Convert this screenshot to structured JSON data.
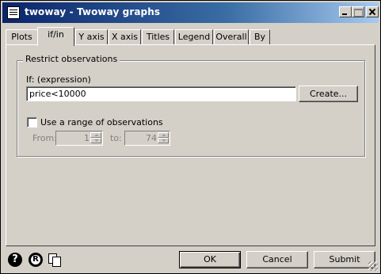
{
  "window": {
    "title": "twoway - Twoway graphs",
    "icon": "form-icon"
  },
  "tabs": [
    {
      "label": "Plots",
      "active": false
    },
    {
      "label": "if/in",
      "active": true
    },
    {
      "label": "Y axis",
      "active": false
    },
    {
      "label": "X axis",
      "active": false
    },
    {
      "label": "Titles",
      "active": false
    },
    {
      "label": "Legend",
      "active": false
    },
    {
      "label": "Overall",
      "active": false
    },
    {
      "label": "By",
      "active": false
    }
  ],
  "restrict": {
    "group_label": "Restrict observations",
    "if_label": "If: (expression)",
    "if_value": "price<10000",
    "create_label": "Create...",
    "range_checkbox_label": "Use a range of observations",
    "range_checked": false,
    "from_label": "From:",
    "from_value": "1",
    "to_label": "to:",
    "to_value": "74"
  },
  "footer": {
    "help_icon": "help-icon",
    "reset_icon": "reset-icon",
    "copy_icon": "copy-icon",
    "help_glyph": "?",
    "reset_glyph": "R",
    "ok_label": "OK",
    "cancel_label": "Cancel",
    "submit_label": "Submit"
  }
}
